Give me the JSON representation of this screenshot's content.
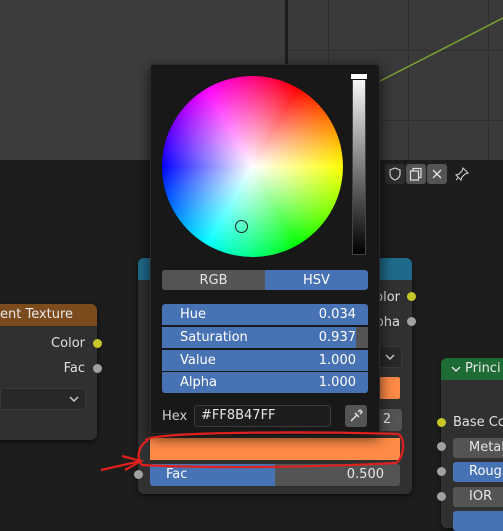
{
  "left_node": {
    "title": "ent Texture",
    "outputs": [
      "Color",
      "Fac"
    ]
  },
  "right_node": {
    "outputs": [
      "olor",
      "pha"
    ],
    "value_field_suffix": "2"
  },
  "bsdf_node": {
    "title": "Princi",
    "inputs": [
      "Base Co",
      "Metal",
      "Rough",
      "IOR"
    ]
  },
  "picker": {
    "mode_tabs": [
      "RGB",
      "HSV"
    ],
    "active_mode": "HSV",
    "fields": [
      {
        "label": "Hue",
        "value": "0.034"
      },
      {
        "label": "Saturation",
        "value": "0.937"
      },
      {
        "label": "Value",
        "value": "1.000"
      },
      {
        "label": "Alpha",
        "value": "1.000"
      }
    ],
    "hex_label": "Hex",
    "hex_value": "#FF8B47FF",
    "color": "#ff8b47"
  },
  "fac": {
    "label": "Fac",
    "value": "0.500",
    "fraction": 0.5
  },
  "colors": {
    "accent": "#4772b3",
    "swatch": "#ff8b47",
    "annotation": "#e0201c",
    "node_header_orange": "#7b4b1e",
    "node_header_green": "#1f6b36",
    "node_header_blue": "#1f6a8a"
  },
  "icons": [
    "shield-icon",
    "copy-icon",
    "close-icon",
    "pin-icon",
    "eyedropper-icon",
    "chevron-down-icon",
    "chevron-down-icon"
  ]
}
